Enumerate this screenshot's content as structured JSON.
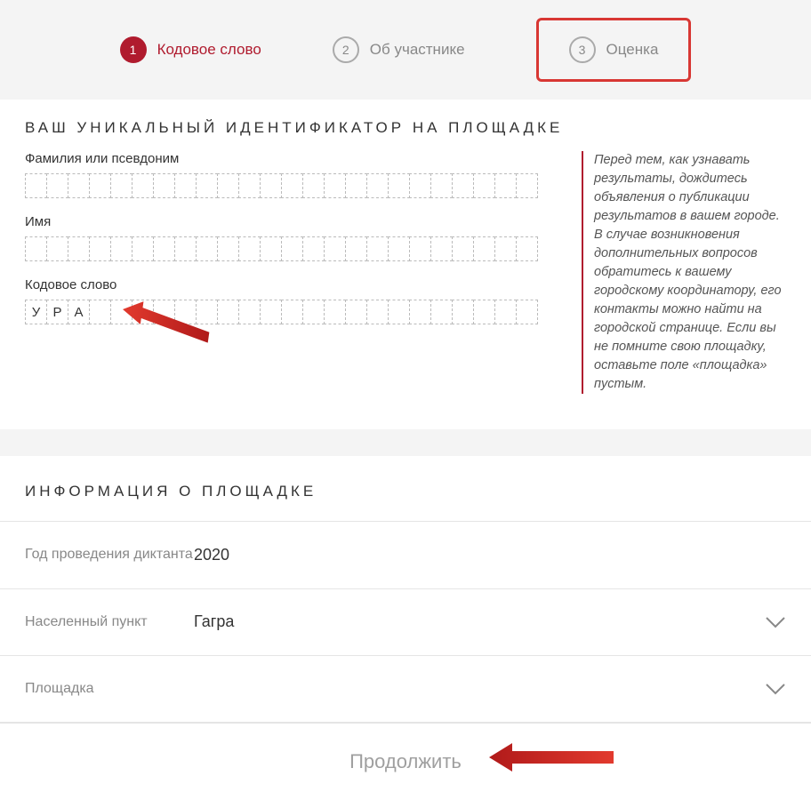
{
  "steps": {
    "s1": {
      "num": "1",
      "label": "Кодовое слово"
    },
    "s2": {
      "num": "2",
      "label": "Об участнике"
    },
    "s3": {
      "num": "3",
      "label": "Оценка"
    }
  },
  "section_identifier_title": "ВАШ УНИКАЛЬНЫЙ ИДЕНТИФИКАТОР НА ПЛОЩАДКЕ",
  "fields": {
    "surname": {
      "label": "Фамилия или псевдоним",
      "chars": [
        "",
        "",
        "",
        "",
        "",
        "",
        "",
        "",
        "",
        "",
        "",
        "",
        "",
        "",
        "",
        "",
        "",
        "",
        "",
        "",
        "",
        "",
        "",
        ""
      ]
    },
    "name": {
      "label": "Имя",
      "chars": [
        "",
        "",
        "",
        "",
        "",
        "",
        "",
        "",
        "",
        "",
        "",
        "",
        "",
        "",
        "",
        "",
        "",
        "",
        "",
        "",
        "",
        "",
        "",
        ""
      ]
    },
    "codeword": {
      "label": "Кодовое слово",
      "chars": [
        "У",
        "Р",
        "А",
        "",
        "",
        "",
        "",
        "",
        "",
        "",
        "",
        "",
        "",
        "",
        "",
        "",
        "",
        "",
        "",
        "",
        "",
        "",
        "",
        ""
      ]
    }
  },
  "hint_text": "Перед тем, как узнавать результаты, дождитесь объявления о публикации результатов в вашем городе. В случае возникновения дополнительных вопросов обратитесь к вашему городскому координатору, его контакты можно найти на городской странице. Если вы не помните свою площадку, оставьте поле «площадка» пустым.",
  "section_info_title": "ИНФОРМАЦИЯ О ПЛОЩАДКЕ",
  "rows": {
    "year": {
      "label": "Год проведения диктанта",
      "value": "2020"
    },
    "city": {
      "label": "Населенный пункт",
      "value": "Гагра"
    },
    "venue": {
      "label": "Площадка",
      "value": ""
    }
  },
  "submit_label": "Продолжить"
}
